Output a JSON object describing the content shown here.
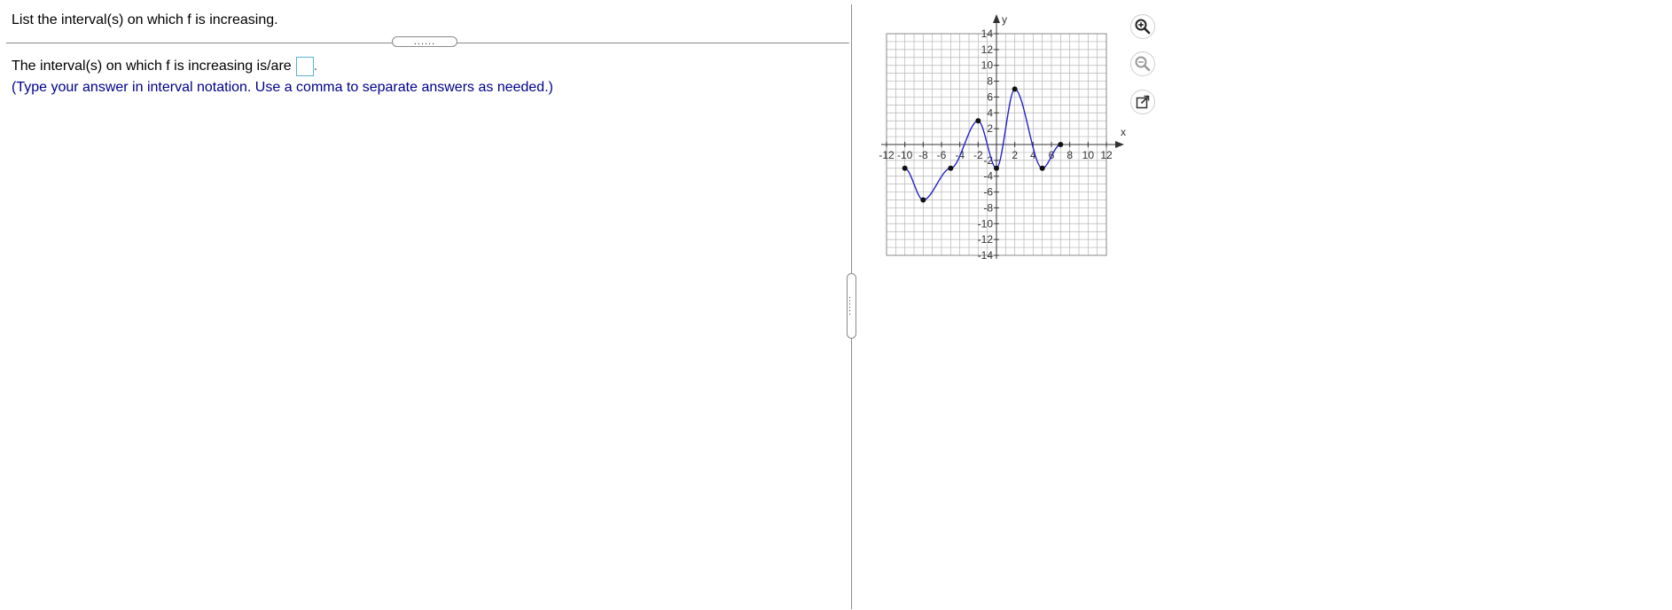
{
  "question": {
    "text": "List the interval(s) on which f is increasing."
  },
  "collapse_handle": {
    "glyph": "......"
  },
  "answer": {
    "prefix": "The interval(s) on which f is increasing is/are",
    "input_value": "",
    "suffix": "."
  },
  "hint": {
    "text": "(Type your answer in interval notation. Use a comma to separate answers as needed.)"
  },
  "vertical_handle": {
    "glyph": "......"
  },
  "graph": {
    "x_axis_label": "x",
    "y_axis_label": "y",
    "x_range": [
      -12,
      12
    ],
    "y_range": [
      -14,
      14
    ],
    "x_ticks": [
      {
        "value": -12,
        "label": "-12"
      },
      {
        "value": -10,
        "label": "-10"
      },
      {
        "value": -8,
        "label": "-8"
      },
      {
        "value": -6,
        "label": "-6"
      },
      {
        "value": -4,
        "label": "-4"
      },
      {
        "value": -2,
        "label": "-2"
      },
      {
        "value": 2,
        "label": "2"
      },
      {
        "value": 4,
        "label": "4"
      },
      {
        "value": 6,
        "label": "6"
      },
      {
        "value": 8,
        "label": "8"
      },
      {
        "value": 10,
        "label": "10"
      },
      {
        "value": 12,
        "label": "12"
      }
    ],
    "y_ticks": [
      {
        "value": 14,
        "label": "14"
      },
      {
        "value": 12,
        "label": "12"
      },
      {
        "value": 10,
        "label": "10"
      },
      {
        "value": 8,
        "label": "8"
      },
      {
        "value": 6,
        "label": "6"
      },
      {
        "value": 4,
        "label": "4"
      },
      {
        "value": 2,
        "label": "2"
      },
      {
        "value": -2,
        "label": "-2"
      },
      {
        "value": -4,
        "label": "-4"
      },
      {
        "value": -6,
        "label": "-6"
      },
      {
        "value": -8,
        "label": "-8"
      },
      {
        "value": -10,
        "label": "-10"
      },
      {
        "value": -12,
        "label": "-12"
      },
      {
        "value": -14,
        "label": "-14"
      }
    ],
    "curve_color": "#2222cc",
    "grid_color": "#b5b5b5",
    "points": [
      {
        "x": -10,
        "y": -3
      },
      {
        "x": -8,
        "y": -7
      },
      {
        "x": -5,
        "y": -3
      },
      {
        "x": -2,
        "y": 3
      },
      {
        "x": 0,
        "y": -3
      },
      {
        "x": 2,
        "y": 7
      },
      {
        "x": 5,
        "y": -3
      },
      {
        "x": 7,
        "y": 0
      }
    ]
  },
  "tools": {
    "zoom_in_icon": "magnifier-plus",
    "zoom_out_icon": "magnifier-minus",
    "popout_icon": "external-link"
  }
}
